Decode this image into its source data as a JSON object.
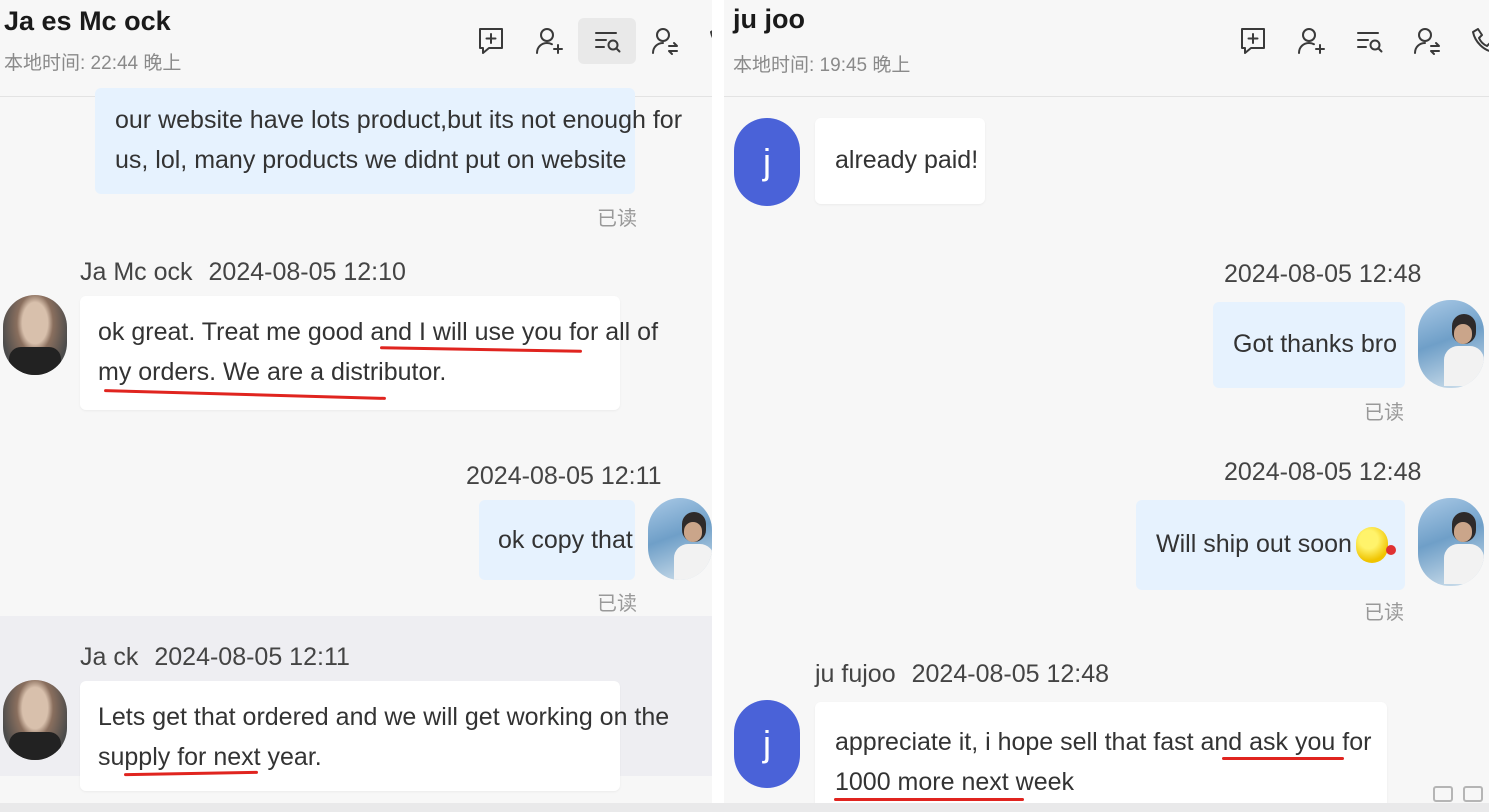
{
  "left": {
    "contact_name": "Ja  es Mc    ock",
    "local_time": "本地时间: 22:44 晚上",
    "messages": [
      {
        "text_line1": "our website have lots product,but its not enough for",
        "text_line2": "us, lol, many products we didnt put on website",
        "read": "已读"
      },
      {
        "sender": "Ja      Mc     ock",
        "time": "2024-08-05 12:10",
        "text_line1": "ok great. Treat me good and I will use you for all of",
        "text_line2": "my orders. We are a distributor."
      },
      {
        "time": "2024-08-05 12:11",
        "text": "ok copy that",
        "read": "已读"
      },
      {
        "sender": "Ja          ck",
        "time": "2024-08-05 12:11",
        "text_line1": "Lets get that ordered and we will get working on the",
        "text_line2": "supply for next year."
      }
    ]
  },
  "right": {
    "contact_name": "ju       joo",
    "local_time": "本地时间: 19:45 晚上",
    "messages": [
      {
        "avatar_letter": "j",
        "text": "already paid!"
      },
      {
        "time": "2024-08-05 12:48",
        "text": "Got thanks bro",
        "read": "已读"
      },
      {
        "time": "2024-08-05 12:48",
        "text": "Will ship out soon",
        "emoji": "grin-emoji-icon",
        "read": "已读"
      },
      {
        "avatar_letter": "j",
        "sender": "ju     fujoo",
        "time": "2024-08-05 12:48",
        "text_line1": "appreciate it, i hope sell that fast and ask you for",
        "text_line2": "1000 more next week"
      }
    ]
  },
  "toolbar_icons": [
    "add-chat-icon",
    "add-contact-icon",
    "search-history-icon",
    "transfer-contact-icon",
    "phone-icon"
  ],
  "colors": {
    "outgoing_bubble": "#e6f2fe",
    "incoming_bubble": "#ffffff",
    "avatar_j": "#4a62d8",
    "annotation_red": "#e0241f"
  }
}
